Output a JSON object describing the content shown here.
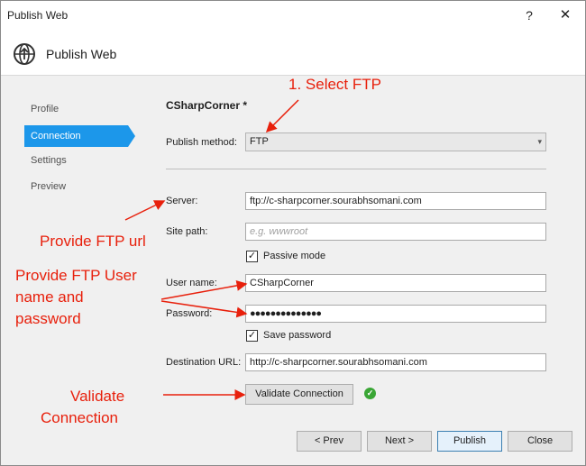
{
  "window": {
    "title": "Publish Web",
    "help_glyph": "?",
    "close_glyph": "✕"
  },
  "header": {
    "title": "Publish Web",
    "icon": "globe-publish-icon"
  },
  "nav": {
    "items": [
      "Profile",
      "Connection",
      "Settings",
      "Preview"
    ],
    "active": "Connection"
  },
  "profile": {
    "name": "CSharpCorner *"
  },
  "form": {
    "publish_method_label": "Publish method:",
    "publish_method_value": "FTP",
    "server_label": "Server:",
    "server_value": "ftp://c-sharpcorner.sourabhsomani.com",
    "site_path_label": "Site path:",
    "site_path_placeholder": "e.g. wwwroot",
    "passive_mode_label": "Passive mode",
    "passive_mode_checked": true,
    "user_name_label": "User name:",
    "user_name_value": "CSharpCorner",
    "password_label": "Password:",
    "password_value": "●●●●●●●●●●●●●●",
    "save_password_label": "Save password",
    "save_password_checked": true,
    "destination_url_label": "Destination URL:",
    "destination_url_value": "http://c-sharpcorner.sourabhsomani.com",
    "validate_button": "Validate Connection",
    "validate_status_icon": "check-circle-icon"
  },
  "footer": {
    "prev": "< Prev",
    "next": "Next >",
    "publish": "Publish",
    "close": "Close"
  },
  "annotations": {
    "select_ftp": "1. Select FTP",
    "provide_url": "Provide FTP url",
    "provide_user_line1": "Provide FTP User",
    "provide_user_line2": "name and",
    "provide_user_line3": "password",
    "validate_line1": "Validate",
    "validate_line2": "Connection",
    "color": "#e8200c"
  }
}
